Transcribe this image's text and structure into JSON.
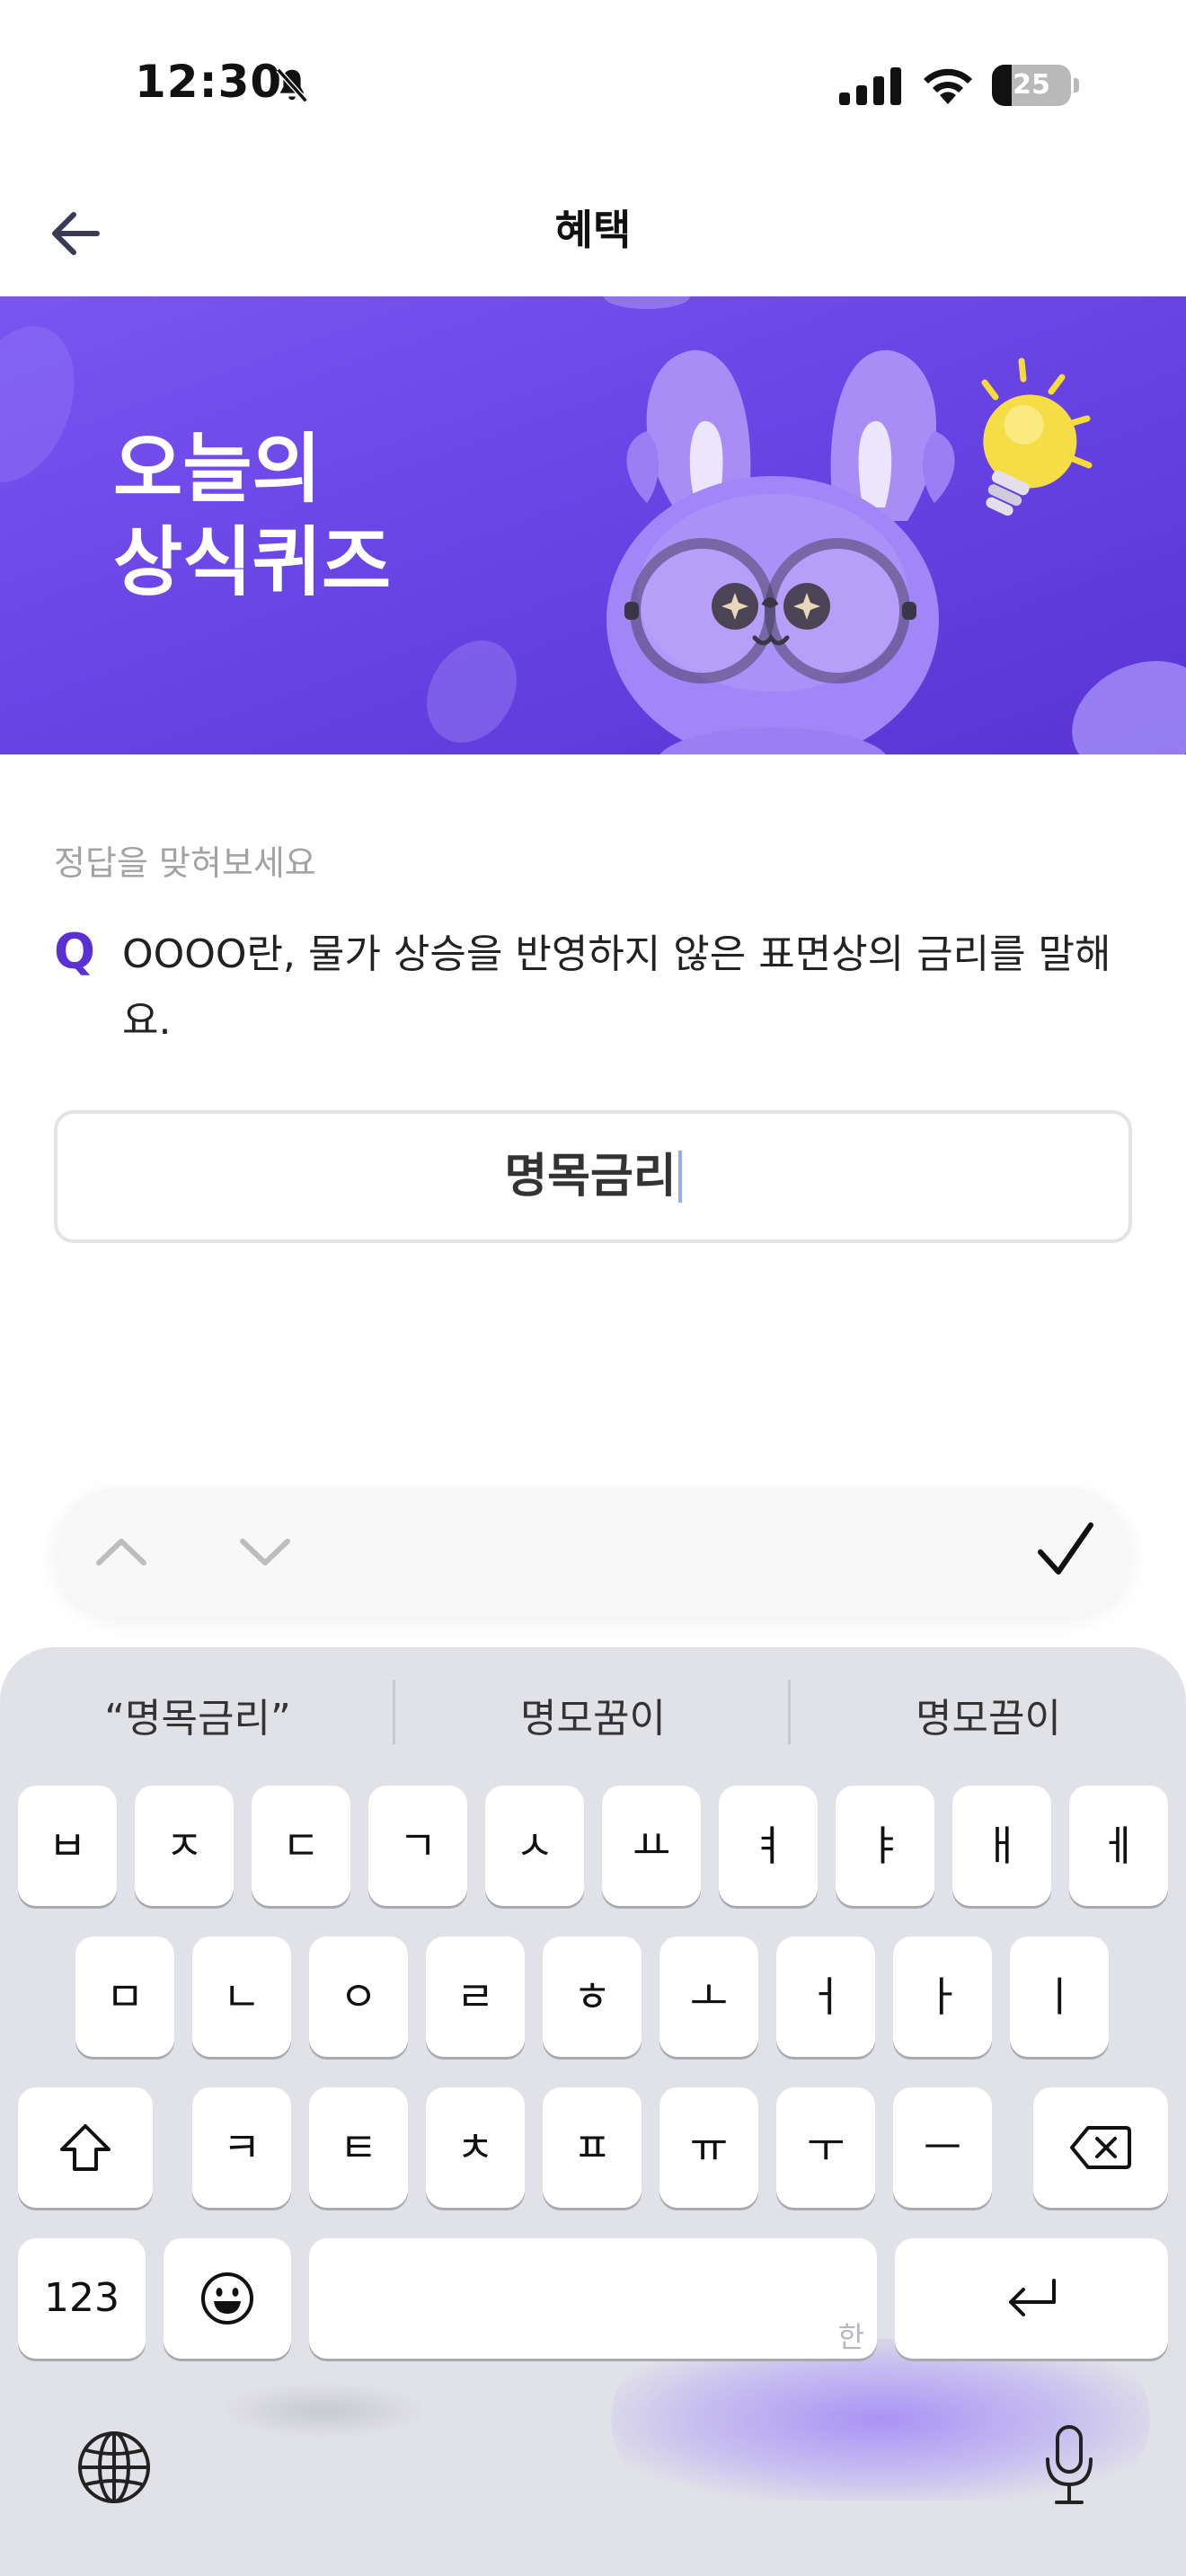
{
  "status_bar": {
    "time": "12:30",
    "battery_level": "25",
    "battery_fraction": 0.25,
    "icons": [
      "bell-slash-icon",
      "cellular-signal-icon",
      "wifi-icon",
      "battery-icon"
    ]
  },
  "nav": {
    "title": "혜택",
    "back_icon": "arrow-left-icon"
  },
  "banner": {
    "title_line1": "오늘의",
    "title_line2": "상식퀴즈",
    "colors": {
      "background": "#6a45e6",
      "text": "#ffffff"
    }
  },
  "quiz": {
    "hint": "정답을 맞혀보세요",
    "q_mark": "Q",
    "question": "OOOO란, 물가 상승을 반영하지 않은 표면상의 금리를 말해요.",
    "answer_value": "명목금리"
  },
  "accessory_bar": {
    "icons": [
      "chevron-up-icon",
      "chevron-down-icon",
      "checkmark-icon"
    ]
  },
  "keyboard": {
    "suggestions": [
      "“명목금리”",
      "명모꿈이",
      "명모끔이"
    ],
    "row1": [
      "ㅂ",
      "ㅈ",
      "ㄷ",
      "ㄱ",
      "ㅅ",
      "ㅛ",
      "ㅕ",
      "ㅑ",
      "ㅐ",
      "ㅔ"
    ],
    "row2": [
      "ㅁ",
      "ㄴ",
      "ㅇ",
      "ㄹ",
      "ㅎ",
      "ㅗ",
      "ㅓ",
      "ㅏ",
      "ㅣ"
    ],
    "row3": [
      "ㅋ",
      "ㅌ",
      "ㅊ",
      "ㅍ",
      "ㅠ",
      "ㅜ",
      "ㅡ"
    ],
    "numbers_key": "123",
    "space_hint": "한",
    "special_icons": [
      "shift-icon",
      "delete-icon",
      "emoji-icon",
      "return-icon",
      "globe-icon",
      "microphone-icon"
    ]
  },
  "colors": {
    "accent": "#5a2fd4",
    "keyboard_bg": "#e1e2e7"
  }
}
